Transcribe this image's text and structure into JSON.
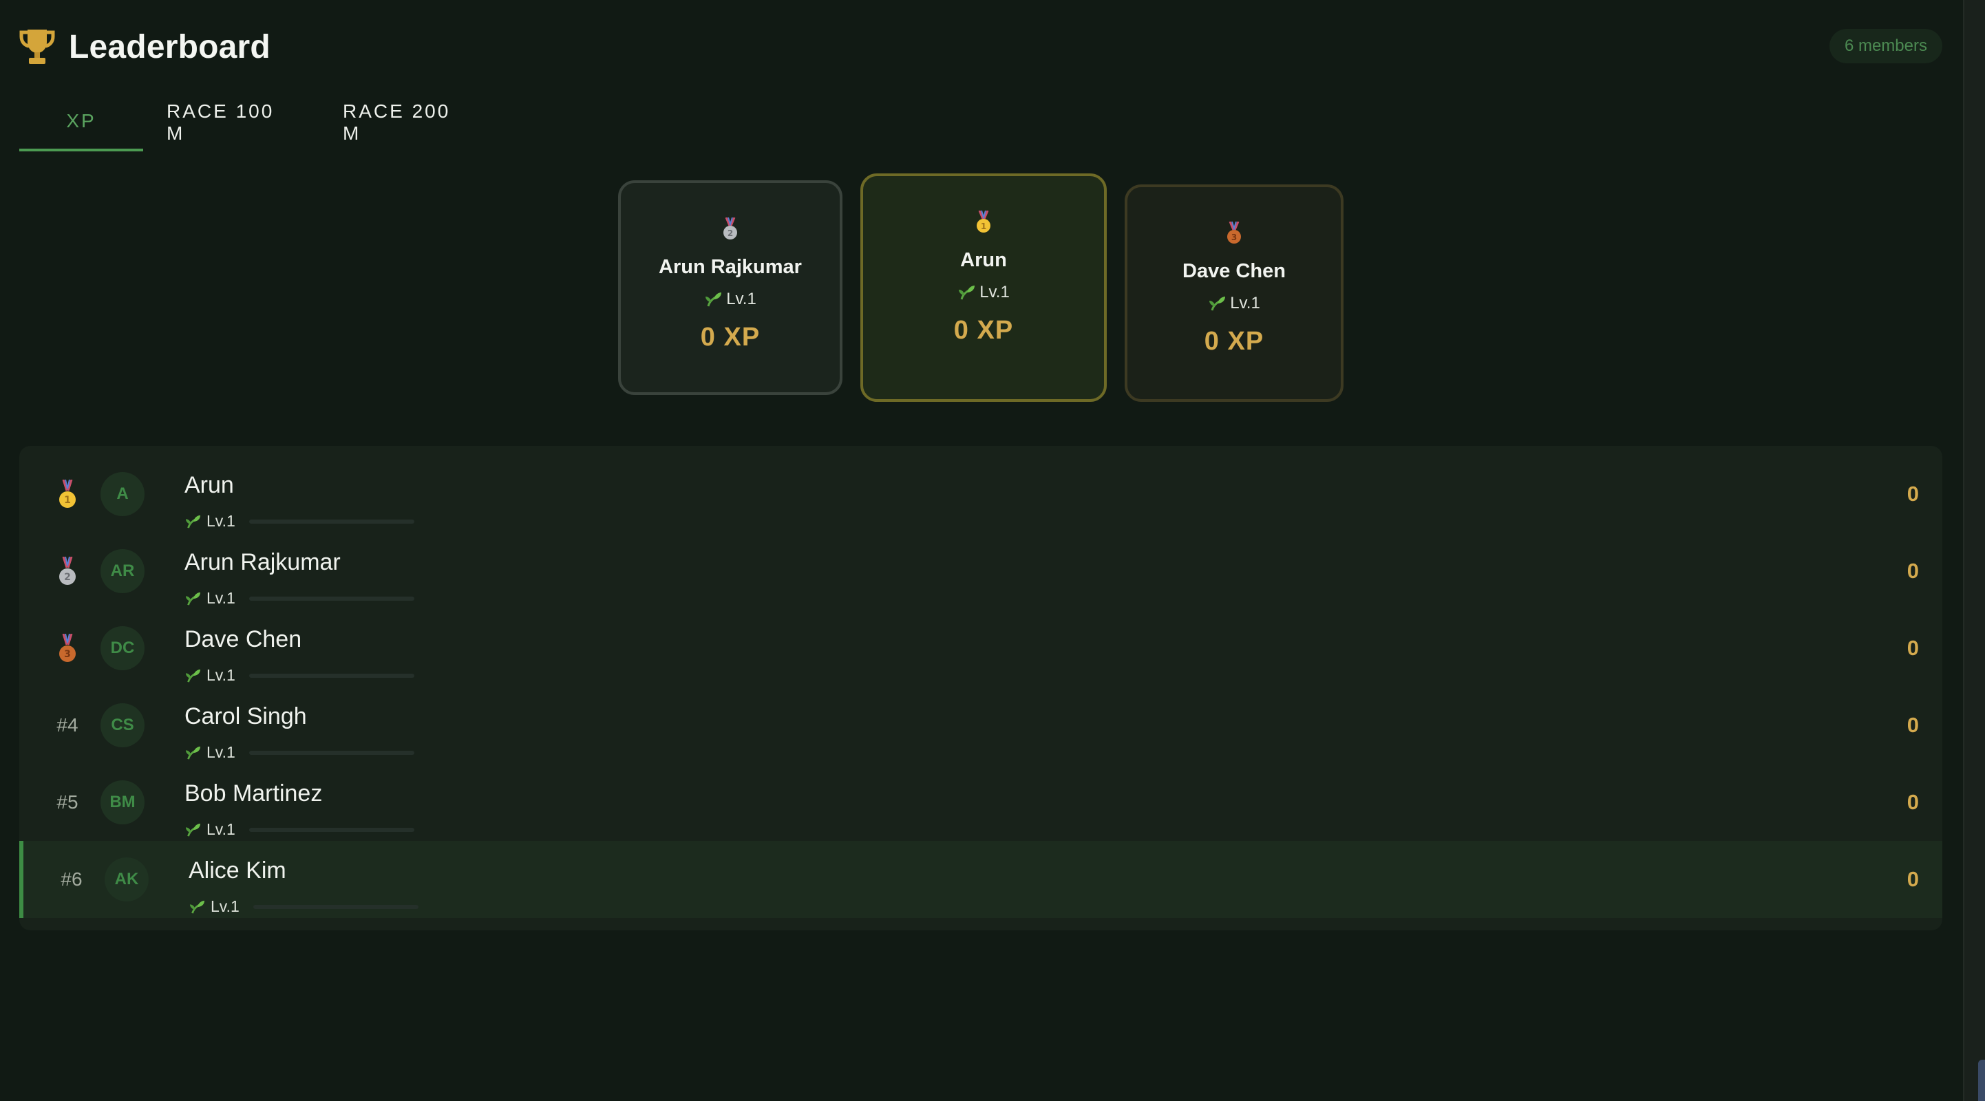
{
  "header": {
    "title": "Leaderboard",
    "members": "6 members"
  },
  "tabs": [
    {
      "label": "XP",
      "active": true
    },
    {
      "label": "RACE 100 M",
      "active": false
    },
    {
      "label": "RACE 200 M",
      "active": false
    }
  ],
  "podium": {
    "first": {
      "name": "Arun",
      "level": "Lv.1",
      "xp": "0 XP",
      "medal": "gold-medal"
    },
    "second": {
      "name": "Arun Rajkumar",
      "level": "Lv.1",
      "xp": "0 XP",
      "medal": "silver-medal"
    },
    "third": {
      "name": "Dave Chen",
      "level": "Lv.1",
      "xp": "0 XP",
      "medal": "bronze-medal"
    }
  },
  "rows": [
    {
      "rank": "",
      "medal": "gold",
      "initials": "A",
      "name": "Arun",
      "level": "Lv.1",
      "score": "0",
      "progress": 0
    },
    {
      "rank": "",
      "medal": "silver",
      "initials": "AR",
      "name": "Arun Rajkumar",
      "level": "Lv.1",
      "score": "0",
      "progress": 0
    },
    {
      "rank": "",
      "medal": "bronze",
      "initials": "DC",
      "name": "Dave Chen",
      "level": "Lv.1",
      "score": "0",
      "progress": 0
    },
    {
      "rank": "#4",
      "medal": "",
      "initials": "CS",
      "name": "Carol Singh",
      "level": "Lv.1",
      "score": "0",
      "progress": 0
    },
    {
      "rank": "#5",
      "medal": "",
      "initials": "BM",
      "name": "Bob Martinez",
      "level": "Lv.1",
      "score": "0",
      "progress": 0
    },
    {
      "rank": "#6",
      "medal": "",
      "initials": "AK",
      "name": "Alice Kim",
      "level": "Lv.1",
      "score": "0",
      "progress": 0,
      "current_user": true
    }
  ],
  "colors": {
    "accent": "#4c9b52",
    "gold": "#d4aa4e",
    "background": "#111a14"
  },
  "icons": {
    "title": "trophy-icon",
    "level": "sprout-icon"
  }
}
